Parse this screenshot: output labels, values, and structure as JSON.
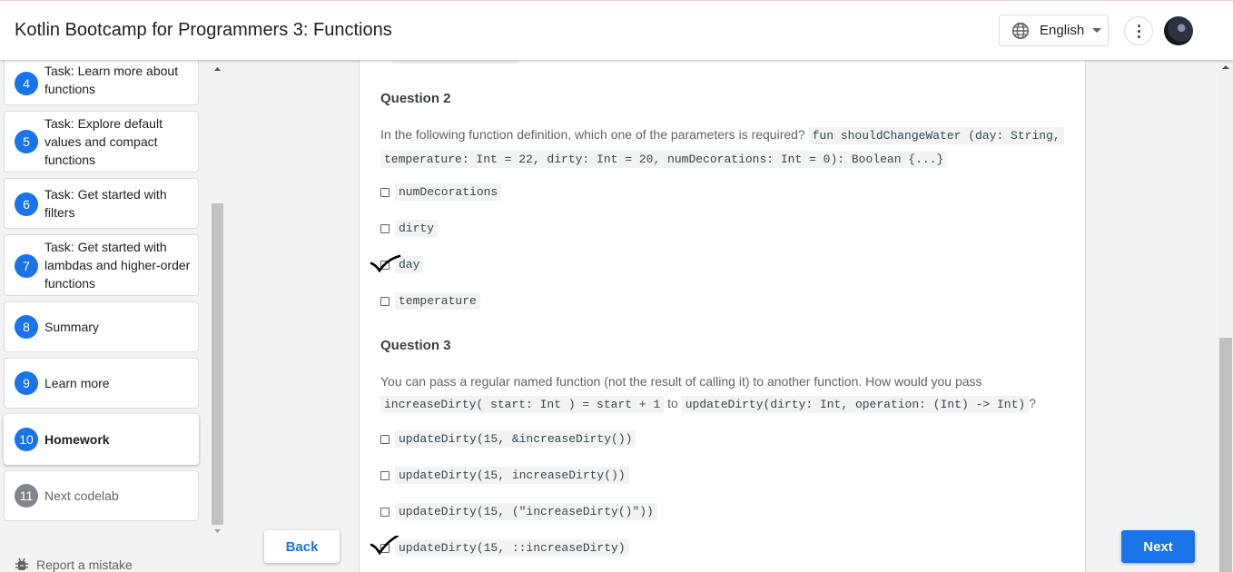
{
  "header": {
    "title": "Kotlin Bootcamp for Programmers 3: Functions",
    "language": "English"
  },
  "sidebar": {
    "steps": [
      {
        "num": "4",
        "label": "Task: Learn more about functions"
      },
      {
        "num": "5",
        "label": "Task: Explore default values and compact functions"
      },
      {
        "num": "6",
        "label": "Task: Get started with filters"
      },
      {
        "num": "7",
        "label": "Task: Get started with lambdas and higher-order functions"
      },
      {
        "num": "8",
        "label": "Summary"
      },
      {
        "num": "9",
        "label": "Learn more"
      },
      {
        "num": "10",
        "label": "Homework"
      },
      {
        "num": "11",
        "label": "Next codelab"
      }
    ],
    "report": "Report a mistake"
  },
  "content": {
    "q2": {
      "title": "Question 2",
      "text_pre": "In the following function definition, which one of the parameters is required?",
      "code_line1": "fun shouldChangeWater (day: String,",
      "code_line2": "temperature: Int = 22, dirty: Int = 20, numDecorations: Int = 0): Boolean {...}",
      "options": [
        "numDecorations",
        "dirty",
        "day",
        "temperature"
      ]
    },
    "q3": {
      "title": "Question 3",
      "text_pre": "You can pass a regular named function (not the result of calling it) to another function. How would you pass",
      "code1": "increaseDirty( start: Int ) = start + 1",
      "to": "to",
      "code2": "updateDirty(dirty: Int, operation: (Int) -> Int)",
      "end": "?",
      "options": [
        "updateDirty(15, &increaseDirty())",
        "updateDirty(15, increaseDirty())",
        "updateDirty(15, (\"increaseDirty()\"))",
        "updateDirty(15, ::increaseDirty)"
      ]
    }
  },
  "nav": {
    "back": "Back",
    "next": "Next"
  },
  "colors": {
    "accent": "#1a73e8",
    "code_bg": "#f1f3f4"
  }
}
